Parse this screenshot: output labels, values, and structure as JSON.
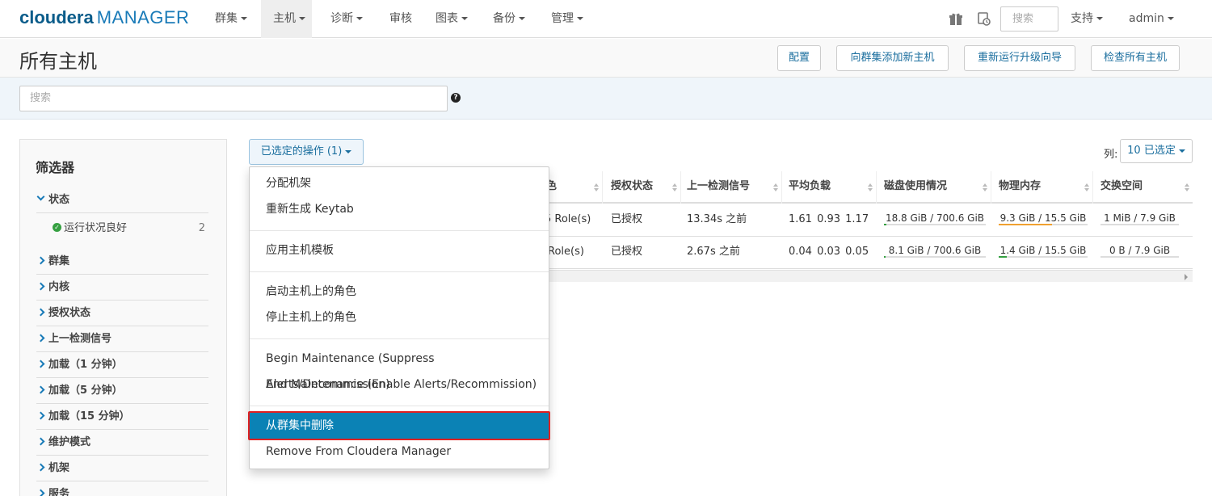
{
  "brand": {
    "name": "cloudera",
    "product": "MANAGER"
  },
  "nav": {
    "items": [
      "群集",
      "主机",
      "诊断",
      "审核",
      "图表",
      "备份",
      "管理"
    ],
    "search_placeholder": "搜索",
    "support": "支持",
    "user": "admin"
  },
  "page": {
    "title": "所有主机",
    "buttons": [
      "配置",
      "向群集添加新主机",
      "重新运行升级向导",
      "检查所有主机"
    ],
    "search_placeholder": "搜索",
    "help": "?"
  },
  "filters": {
    "title": "筛选器",
    "status_label": "状态",
    "status_item": {
      "label": "运行状况良好",
      "count": "2"
    },
    "groups": [
      "群集",
      "内核",
      "授权状态",
      "上一检测信号",
      "加载（1 分钟）",
      "加载（5 分钟）",
      "加载（15 分钟）",
      "维护模式",
      "机架",
      "服务"
    ]
  },
  "actions": {
    "label": "已选定的操作 (1)",
    "columns_label": "列:",
    "columns_value": "10 已选定"
  },
  "table": {
    "headers": [
      "色",
      "授权状态",
      "上一检测信号",
      "平均负载",
      "磁盘使用情况",
      "物理内存",
      "交换空间"
    ],
    "rows": [
      {
        "roles": "5 Role(s)",
        "auth": "已授权",
        "heartbeat": "13.34s 之前",
        "load": "1.61  0.93  1.17",
        "disk": "18.8 GiB / 700.6 GiB",
        "mem": "9.3 GiB / 15.5 GiB",
        "swap": "1 MiB / 7.9 GiB"
      },
      {
        "roles": "Role(s)",
        "auth": "已授权",
        "heartbeat": "2.67s 之前",
        "load": "0.04  0.03  0.05",
        "disk": "8.1 GiB / 700.6 GiB",
        "mem": "1.4 GiB / 15.5 GiB",
        "swap": "0 B / 7.9 GiB"
      }
    ]
  },
  "dropdown": {
    "items": [
      "分配机架",
      "重新生成 Keytab",
      "应用主机模板",
      "启动主机上的角色",
      "停止主机上的角色",
      "Begin Maintenance (Suppress Alerts/Decommission)",
      "End Maintenance (Enable Alerts/Recommission)",
      "从群集中删除",
      "Remove From Cloudera Manager"
    ],
    "highlighted": "从群集中删除"
  },
  "colors": {
    "accent": "#1a7bb8",
    "highlight": "#0b82b5",
    "outline": "#e02020",
    "ok": "#35a041"
  }
}
